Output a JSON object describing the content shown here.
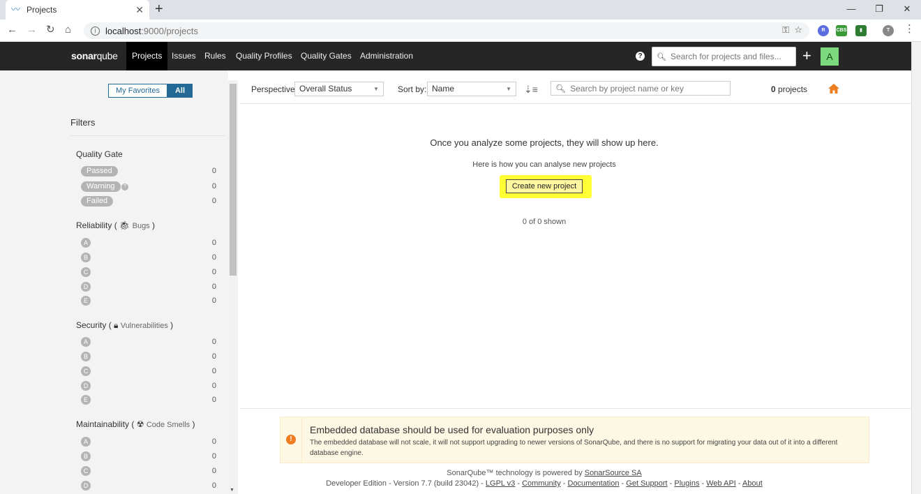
{
  "browser": {
    "tab_title": "Projects",
    "close": "✕",
    "new_tab": "+",
    "url_host": "localhost",
    "url_rest": ":9000/projects"
  },
  "header": {
    "logo_a": "sonar",
    "logo_b": "qube",
    "menu": [
      "Projects",
      "Issues",
      "Rules",
      "Quality Profiles",
      "Quality Gates",
      "Administration"
    ],
    "search_placeholder": "Search for projects and files...",
    "avatar_letter": "A"
  },
  "sidebar": {
    "my_favorites": "My Favorites",
    "all": "All",
    "filters_title": "Filters",
    "quality_gate": {
      "title": "Quality Gate",
      "items": [
        {
          "label": "Passed",
          "count": "0"
        },
        {
          "label": "Warning",
          "count": "0"
        },
        {
          "label": "Failed",
          "count": "0"
        }
      ]
    },
    "reliability": {
      "title": "Reliability",
      "sub": "Bugs",
      "ratings": [
        "A",
        "B",
        "C",
        "D",
        "E"
      ],
      "counts": [
        "0",
        "0",
        "0",
        "0",
        "0"
      ]
    },
    "security": {
      "title": "Security",
      "sub": "Vulnerabilities",
      "ratings": [
        "A",
        "B",
        "C",
        "D",
        "E"
      ],
      "counts": [
        "0",
        "0",
        "0",
        "0",
        "0"
      ]
    },
    "maintainability": {
      "title": "Maintainability",
      "sub": "Code Smells",
      "ratings": [
        "A",
        "B",
        "C",
        "D"
      ],
      "counts": [
        "0",
        "0",
        "0",
        "0"
      ]
    }
  },
  "toolbar": {
    "perspective_label": "Perspective:",
    "perspective_value": "Overall Status",
    "sort_label": "Sort by:",
    "sort_value": "Name",
    "search_placeholder": "Search by project name or key",
    "count_num": "0",
    "count_label": "projects"
  },
  "empty": {
    "title": "Once you analyze some projects, they will show up here.",
    "subtitle": "Here is how you can analyse new projects",
    "create_button": "Create new project",
    "shown": "0 of 0 shown"
  },
  "warning": {
    "title": "Embedded database should be used for evaluation purposes only",
    "body": "The embedded database will not scale, it will not support upgrading to newer versions of SonarQube, and there is no support for migrating your data out of it into a different database engine."
  },
  "footer": {
    "powered": "SonarQube™ technology is powered by",
    "powered_link": "SonarSource SA",
    "edition": "Developer Edition - Version 7.7 (build 23042) -",
    "links": [
      "LGPL v3",
      "Community",
      "Documentation",
      "Get Support",
      "Plugins",
      "Web API",
      "About"
    ]
  },
  "colors": {
    "accent": "#236a97",
    "highlight": "#ffff33",
    "nav_bg": "#262626",
    "home": "#ed7d20"
  }
}
